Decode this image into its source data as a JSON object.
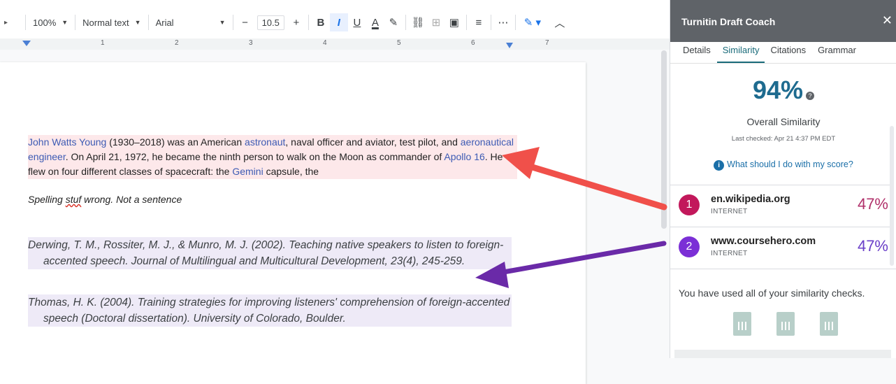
{
  "toolbar": {
    "zoom": "100%",
    "style": "Normal text",
    "font": "Arial",
    "font_size": "10.5",
    "minus": "−",
    "plus": "+",
    "bold": "B",
    "italic": "I",
    "underline": "U",
    "text_color": "A",
    "more": "⋯"
  },
  "ruler": {
    "labels": [
      "1",
      "2",
      "3",
      "4",
      "5",
      "6",
      "7"
    ]
  },
  "document": {
    "para1": {
      "link1": "John Watts Young",
      "t1": " (1930–2018) was an American ",
      "link2": "astronaut",
      "t2": ", naval officer and aviator, test pilot, and ",
      "link3": "aeronautical engineer",
      "t3": ". On April 21, 1972, he became the ninth person to walk on the Moon as commander of ",
      "link4": "Apollo 16",
      "t4": ". He flew on four different classes of spacecraft: the ",
      "link5": "Gemini",
      "t5": " capsule, the"
    },
    "para2": {
      "before": "Spelling ",
      "misspelled": "stuf",
      "after": " wrong.  Not a sentence"
    },
    "ref1": "Derwing, T. M., Rossiter, M. J., & Munro, M. J. (2002). Teaching native speakers to listen to foreign-accented speech. Journal of Multilingual and Multicultural Development, 23(4), 245-259.",
    "ref2": "Thomas, H. K. (2004). Training strategies for improving listeners' comprehension of foreign-accented speech (Doctoral dissertation). University of Colorado, Boulder."
  },
  "panel": {
    "title": "Turnitin Draft Coach",
    "close": "✕",
    "tabs": [
      "Details",
      "Similarity",
      "Citations",
      "Grammar"
    ],
    "active_tab": "Similarity",
    "score": "94%",
    "score_label": "Overall Similarity",
    "last_checked": "Last checked: Apr 21 4:37 PM EDT",
    "help_link": "What should I do with my score?",
    "sources": [
      {
        "num": "1",
        "name": "en.wikipedia.org",
        "type": "INTERNET",
        "pct": "47%",
        "color": "#c2185b",
        "text_color": "#b0306a"
      },
      {
        "num": "2",
        "name": "www.coursehero.com",
        "type": "INTERNET",
        "pct": "47%",
        "color": "#7b2fd6",
        "text_color": "#6a3fc8"
      }
    ],
    "used_msg": "You have used all of your similarity checks."
  },
  "colors": {
    "arrow_red": "#f0504a",
    "arrow_purple": "#6a2aa8",
    "accent": "#1a6b7a"
  }
}
